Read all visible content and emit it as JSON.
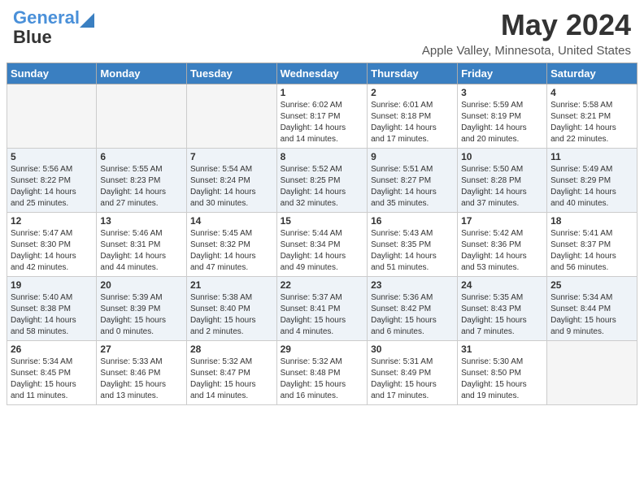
{
  "header": {
    "logo_line1": "General",
    "logo_line2": "Blue",
    "title": "May 2024",
    "subtitle": "Apple Valley, Minnesota, United States"
  },
  "days_of_week": [
    "Sunday",
    "Monday",
    "Tuesday",
    "Wednesday",
    "Thursday",
    "Friday",
    "Saturday"
  ],
  "weeks": [
    [
      {
        "day": "",
        "info": ""
      },
      {
        "day": "",
        "info": ""
      },
      {
        "day": "",
        "info": ""
      },
      {
        "day": "1",
        "info": "Sunrise: 6:02 AM\nSunset: 8:17 PM\nDaylight: 14 hours\nand 14 minutes."
      },
      {
        "day": "2",
        "info": "Sunrise: 6:01 AM\nSunset: 8:18 PM\nDaylight: 14 hours\nand 17 minutes."
      },
      {
        "day": "3",
        "info": "Sunrise: 5:59 AM\nSunset: 8:19 PM\nDaylight: 14 hours\nand 20 minutes."
      },
      {
        "day": "4",
        "info": "Sunrise: 5:58 AM\nSunset: 8:21 PM\nDaylight: 14 hours\nand 22 minutes."
      }
    ],
    [
      {
        "day": "5",
        "info": "Sunrise: 5:56 AM\nSunset: 8:22 PM\nDaylight: 14 hours\nand 25 minutes."
      },
      {
        "day": "6",
        "info": "Sunrise: 5:55 AM\nSunset: 8:23 PM\nDaylight: 14 hours\nand 27 minutes."
      },
      {
        "day": "7",
        "info": "Sunrise: 5:54 AM\nSunset: 8:24 PM\nDaylight: 14 hours\nand 30 minutes."
      },
      {
        "day": "8",
        "info": "Sunrise: 5:52 AM\nSunset: 8:25 PM\nDaylight: 14 hours\nand 32 minutes."
      },
      {
        "day": "9",
        "info": "Sunrise: 5:51 AM\nSunset: 8:27 PM\nDaylight: 14 hours\nand 35 minutes."
      },
      {
        "day": "10",
        "info": "Sunrise: 5:50 AM\nSunset: 8:28 PM\nDaylight: 14 hours\nand 37 minutes."
      },
      {
        "day": "11",
        "info": "Sunrise: 5:49 AM\nSunset: 8:29 PM\nDaylight: 14 hours\nand 40 minutes."
      }
    ],
    [
      {
        "day": "12",
        "info": "Sunrise: 5:47 AM\nSunset: 8:30 PM\nDaylight: 14 hours\nand 42 minutes."
      },
      {
        "day": "13",
        "info": "Sunrise: 5:46 AM\nSunset: 8:31 PM\nDaylight: 14 hours\nand 44 minutes."
      },
      {
        "day": "14",
        "info": "Sunrise: 5:45 AM\nSunset: 8:32 PM\nDaylight: 14 hours\nand 47 minutes."
      },
      {
        "day": "15",
        "info": "Sunrise: 5:44 AM\nSunset: 8:34 PM\nDaylight: 14 hours\nand 49 minutes."
      },
      {
        "day": "16",
        "info": "Sunrise: 5:43 AM\nSunset: 8:35 PM\nDaylight: 14 hours\nand 51 minutes."
      },
      {
        "day": "17",
        "info": "Sunrise: 5:42 AM\nSunset: 8:36 PM\nDaylight: 14 hours\nand 53 minutes."
      },
      {
        "day": "18",
        "info": "Sunrise: 5:41 AM\nSunset: 8:37 PM\nDaylight: 14 hours\nand 56 minutes."
      }
    ],
    [
      {
        "day": "19",
        "info": "Sunrise: 5:40 AM\nSunset: 8:38 PM\nDaylight: 14 hours\nand 58 minutes."
      },
      {
        "day": "20",
        "info": "Sunrise: 5:39 AM\nSunset: 8:39 PM\nDaylight: 15 hours\nand 0 minutes."
      },
      {
        "day": "21",
        "info": "Sunrise: 5:38 AM\nSunset: 8:40 PM\nDaylight: 15 hours\nand 2 minutes."
      },
      {
        "day": "22",
        "info": "Sunrise: 5:37 AM\nSunset: 8:41 PM\nDaylight: 15 hours\nand 4 minutes."
      },
      {
        "day": "23",
        "info": "Sunrise: 5:36 AM\nSunset: 8:42 PM\nDaylight: 15 hours\nand 6 minutes."
      },
      {
        "day": "24",
        "info": "Sunrise: 5:35 AM\nSunset: 8:43 PM\nDaylight: 15 hours\nand 7 minutes."
      },
      {
        "day": "25",
        "info": "Sunrise: 5:34 AM\nSunset: 8:44 PM\nDaylight: 15 hours\nand 9 minutes."
      }
    ],
    [
      {
        "day": "26",
        "info": "Sunrise: 5:34 AM\nSunset: 8:45 PM\nDaylight: 15 hours\nand 11 minutes."
      },
      {
        "day": "27",
        "info": "Sunrise: 5:33 AM\nSunset: 8:46 PM\nDaylight: 15 hours\nand 13 minutes."
      },
      {
        "day": "28",
        "info": "Sunrise: 5:32 AM\nSunset: 8:47 PM\nDaylight: 15 hours\nand 14 minutes."
      },
      {
        "day": "29",
        "info": "Sunrise: 5:32 AM\nSunset: 8:48 PM\nDaylight: 15 hours\nand 16 minutes."
      },
      {
        "day": "30",
        "info": "Sunrise: 5:31 AM\nSunset: 8:49 PM\nDaylight: 15 hours\nand 17 minutes."
      },
      {
        "day": "31",
        "info": "Sunrise: 5:30 AM\nSunset: 8:50 PM\nDaylight: 15 hours\nand 19 minutes."
      },
      {
        "day": "",
        "info": ""
      }
    ]
  ]
}
